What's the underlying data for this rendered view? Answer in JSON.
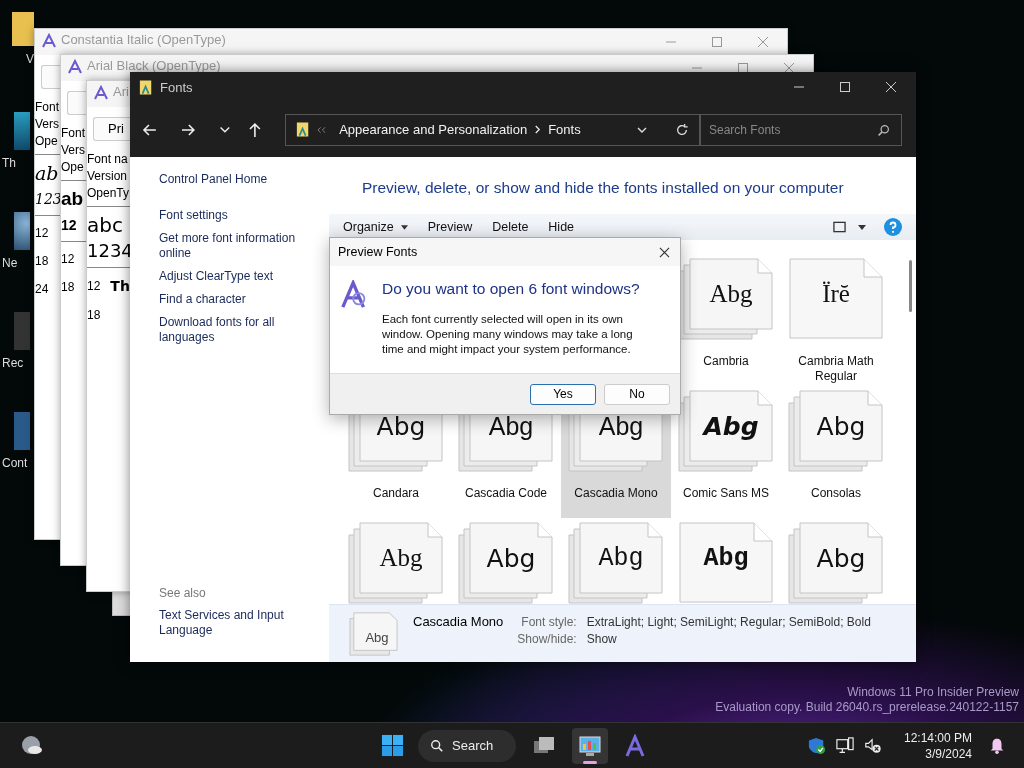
{
  "desktop_icons": [
    {
      "label": "V"
    },
    {
      "label": "Th"
    },
    {
      "label": "Ne"
    },
    {
      "label": "Rec"
    },
    {
      "label": "Cont"
    }
  ],
  "preview_windows": [
    {
      "title": "Constantia Italic (OpenType)",
      "info": [
        "Font",
        "Vers",
        "Ope"
      ],
      "samples": [
        "ab",
        "123"
      ],
      "sizes": [
        {
          "size": "12"
        },
        {
          "size": "18"
        },
        {
          "size": "24"
        }
      ]
    },
    {
      "title": "Arial Black (OpenType)",
      "info": [
        "Font",
        "Vers",
        "Ope"
      ],
      "samples": [
        "ab",
        "12"
      ],
      "sizes": [
        {
          "size": "12"
        },
        {
          "size": "18"
        }
      ]
    },
    {
      "title": "Ari",
      "button": "Pri",
      "info": [
        "Font na",
        "Version",
        "OpenTy"
      ],
      "samples": [
        "abc",
        "1234"
      ],
      "sizes": [
        {
          "size": "12",
          "sample": "Th"
        },
        {
          "size": "18"
        }
      ]
    }
  ],
  "fonts_window": {
    "title": "Fonts",
    "breadcrumb": [
      "Appearance and Personalization",
      "Fonts"
    ],
    "search": {
      "placeholder": "Search Fonts"
    },
    "sidebar": {
      "links": [
        "Control Panel Home",
        "Font settings",
        "Get more font information online",
        "Adjust ClearType text",
        "Find a character",
        "Download fonts for all languages"
      ],
      "see_also": "See also",
      "see_also_links": [
        "Text Services and Input Language"
      ]
    },
    "heading": "Preview, delete, or show and hide the fonts installed on your computer",
    "toolbar": [
      {
        "label": "Organize",
        "dropdown": true
      },
      {
        "label": "Preview",
        "dropdown": false
      },
      {
        "label": "Delete",
        "dropdown": false
      },
      {
        "label": "Hide",
        "dropdown": false
      }
    ],
    "fonts": [
      {
        "name": "Cambria",
        "sample": "Abg",
        "kind": "family",
        "selected": false
      },
      {
        "name": "Cambria Math Regular",
        "sample": "Ïrĕ",
        "kind": "single",
        "selected": false
      },
      {
        "name": "Candara",
        "sample": "Abg",
        "kind": "family",
        "selected": false
      },
      {
        "name": "Cascadia Code",
        "sample": "Abg",
        "kind": "family",
        "selected": false
      },
      {
        "name": "Cascadia Mono",
        "sample": "Abg",
        "kind": "family",
        "selected": true
      },
      {
        "name": "Comic Sans MS",
        "sample": "Abg",
        "kind": "family",
        "selected": false
      },
      {
        "name": "Consolas",
        "sample": "Abg",
        "kind": "family",
        "selected": false
      },
      {
        "sample": "Abg",
        "kind": "family",
        "selected": false
      },
      {
        "sample": "Abg",
        "kind": "family",
        "selected": false
      },
      {
        "sample": "Abg",
        "kind": "family",
        "selected": false
      },
      {
        "sample": "Abg",
        "kind": "single",
        "selected": false
      },
      {
        "sample": "Abg",
        "kind": "family",
        "selected": false
      }
    ],
    "details": {
      "name": "Cascadia Mono",
      "sample": "Abg",
      "fields": [
        {
          "label": "Font style:",
          "value": "ExtraLight; Light; SemiLight; Regular; SemiBold; Bold"
        },
        {
          "label": "Show/hide:",
          "value": "Show"
        }
      ]
    }
  },
  "dialog": {
    "title": "Preview Fonts",
    "question": "Do you want to open 6 font windows?",
    "message": "Each font currently selected will open in its own window. Opening many windows may take a long time and might impact your system performance.",
    "buttons": [
      {
        "label": "Yes",
        "default": true
      },
      {
        "label": "No",
        "default": false
      }
    ]
  },
  "watermark": [
    "Windows 11 Pro Insider Preview",
    "Evaluation copy. Build 26040.rs_prerelease.240122-1157"
  ],
  "taskbar": {
    "search": "Search",
    "apps": [
      {
        "kind": "taskview",
        "active": false
      },
      {
        "kind": "control-panel",
        "active": true
      },
      {
        "kind": "fonts",
        "active": false
      }
    ],
    "time": "12:14:00 PM",
    "date": "3/9/2024"
  }
}
